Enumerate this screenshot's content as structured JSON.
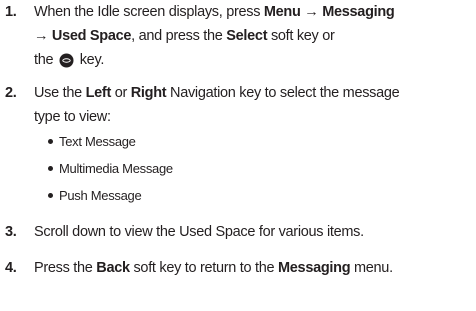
{
  "steps": [
    {
      "number": "1.",
      "line1": {
        "t1": "When the Idle screen displays, press ",
        "b1": "Menu",
        "t2": " → ",
        "b2": "Messaging"
      },
      "line2": {
        "b1": "→ Used Space",
        "t1": ", and press the ",
        "b2": "Select",
        "t2": " soft key or"
      },
      "line3": {
        "t1": "the ",
        "t2": " key."
      },
      "icon": "ok-key-icon"
    },
    {
      "number": "2.",
      "line1": {
        "t1": "Use the ",
        "b1": "Left",
        "t2": " or ",
        "b2": "Right",
        "t3": " Navigation key to select the message"
      },
      "line2": "type to view:",
      "bullets": [
        "Text Message",
        "Multimedia Message",
        "Push Message"
      ]
    },
    {
      "number": "3.",
      "text": "Scroll down to view the Used Space for various items."
    },
    {
      "number": "4.",
      "line1": {
        "t1": "Press the ",
        "b1": "Back",
        "t2": " soft key to return to the ",
        "b2": "Messaging",
        "t3": " menu."
      }
    }
  ]
}
